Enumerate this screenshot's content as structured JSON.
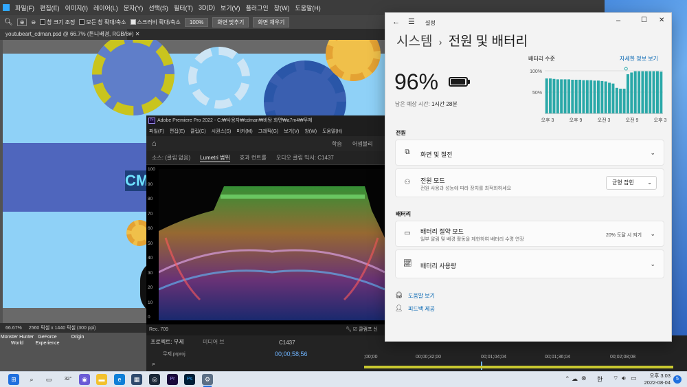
{
  "photoshop": {
    "menu": [
      "파일(F)",
      "편집(E)",
      "이미지(I)",
      "레이어(L)",
      "문자(Y)",
      "선택(S)",
      "필터(T)",
      "3D(D)",
      "보기(V)",
      "플러그인",
      "창(W)",
      "도움말(H)"
    ],
    "options": {
      "fit_all_windows": "창 크기 조정",
      "zoom_all_windows": "모든 창 확대/축소",
      "scrubby_zoom": "스크러비 확대/축소",
      "zoom_value": "100%",
      "fit_screen_button": "화면 맞추기",
      "fill_screen_button": "화면 채우기"
    },
    "doc_tab": "youtubeart_cdman.psd @ 66.7% (튼니배경, RGB/8#)",
    "status": {
      "zoom": "66.67%",
      "size": "2560 픽셀 x 1440 픽셀 (300 ppi)"
    }
  },
  "desktop_icons": [
    {
      "label": "Monster Hunter World",
      "color": "#3a3a3a"
    },
    {
      "label": "GeForce Experience",
      "color": "#76b900"
    },
    {
      "label": "Origin",
      "color": "#f56c2d"
    }
  ],
  "premiere": {
    "title": "Adobe Premiere Pro 2022 - C:₩사용자₩cdman₩바탕 화면₩a7m4₩무제",
    "menu": [
      "파일(F)",
      "편집(E)",
      "클립(C)",
      "시퀀스(S)",
      "마커(M)",
      "그래픽(G)",
      "보기(V)",
      "창(W)",
      "도움말(H)"
    ],
    "workspaces": [
      "학습",
      "어셈블리"
    ],
    "panel_tabs": [
      "소스: (클립 없음)",
      "Lumetri 범위",
      "효과 컨트롤",
      "오디오 클립 믹서: C1437"
    ],
    "active_tab": "Lumetri 범위",
    "scope_scale": [
      "100",
      "90",
      "80",
      "70",
      "60",
      "50",
      "40",
      "30",
      "20",
      "10",
      "0"
    ],
    "rec": "Rec. 709",
    "clamp_label": "클램프 신",
    "project_tab": "프로젝트: 무제",
    "media_tab": "미디어 브",
    "project_file": "무제.prproj",
    "sequence_name": "C1437",
    "timecode": "00;00;58;56",
    "ruler": [
      ";00;00",
      "00;00;32;00",
      "00;01;04;04",
      "00;01;36;04",
      "00;02;08;08"
    ]
  },
  "settings": {
    "app_title": "설정",
    "breadcrumb_parent": "시스템",
    "breadcrumb_sep": "›",
    "page_title": "전원 및 배터리",
    "battery_percent": "96%",
    "battery_level": 0.96,
    "remaining_label": "남은 예상 시간:",
    "remaining_value": "1시간 28분",
    "chart": {
      "title": "배터리 수준",
      "details_link": "자세한 정보 보기"
    },
    "power_section": "전원",
    "screen_sleep": "화면 및 절전",
    "power_mode_title": "전원 모드",
    "power_mode_desc": "전원 사용과 성능에 따라 장치를 최적화하세요",
    "power_mode_value": "균형 잡힌",
    "battery_section": "배터리",
    "saver_title": "배터리 절약 모드",
    "saver_desc": "일부 알림 및 배경 활동을 제한하여 배터리 수명 연장",
    "saver_value": "20% 도달 시 켜기",
    "usage_title": "배터리 사용량",
    "help_link": "도움말 보기",
    "feedback_link": "피드백 제공"
  },
  "chart_data": {
    "type": "bar",
    "title": "배터리 수준",
    "yticks": [
      "100%",
      "50%"
    ],
    "xticks": [
      "오후 3",
      "오후 9",
      "오전 3",
      "오전 9",
      "오후 3"
    ],
    "ylim": [
      0,
      100
    ],
    "values": [
      82,
      82,
      81,
      80,
      80,
      80,
      80,
      79,
      79,
      79,
      78,
      78,
      78,
      77,
      77,
      76,
      75,
      72,
      70,
      60,
      58,
      58,
      92,
      96,
      99,
      99,
      99,
      99,
      99,
      99,
      99,
      98
    ],
    "color": "#2aa8a8",
    "grid": true
  },
  "timeline": {
    "zero": ";00;00"
  },
  "taskbar": {
    "weather": "32°",
    "ime": "한",
    "time": "오후 3:03",
    "date": "2022-08-04",
    "notifications": "5"
  }
}
